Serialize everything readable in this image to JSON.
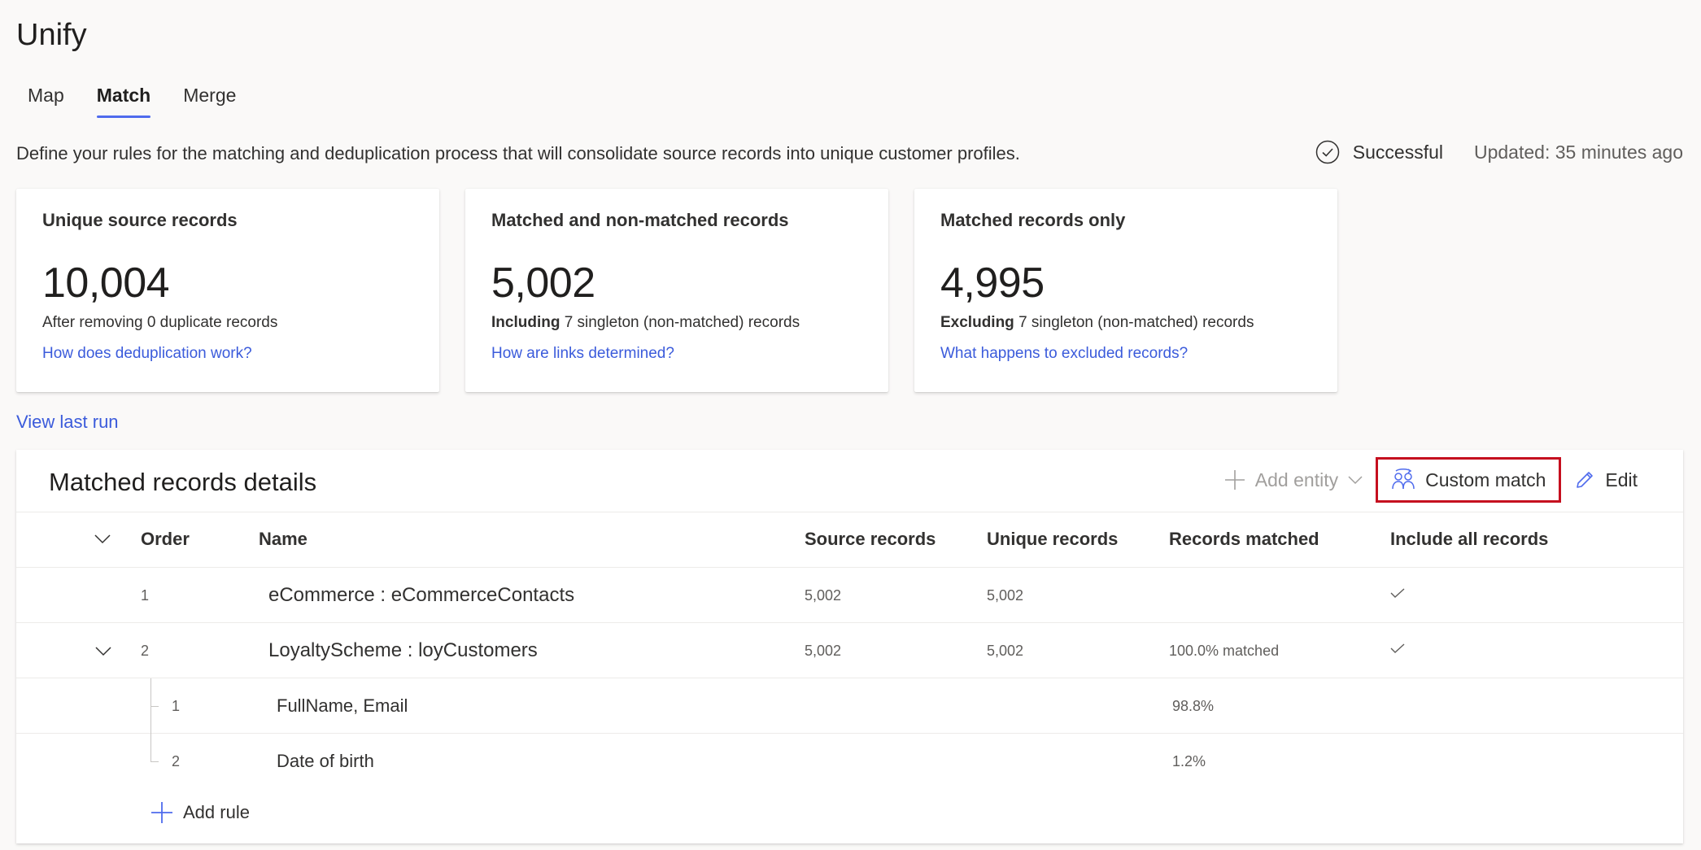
{
  "page": {
    "title": "Unify",
    "tabs": [
      {
        "label": "Map"
      },
      {
        "label": "Match"
      },
      {
        "label": "Merge"
      }
    ],
    "active_tab": "Match",
    "description": "Define your rules for the matching and deduplication process that will consolidate source records into unique customer profiles.",
    "status": {
      "label": "Successful",
      "updated": "Updated: 35 minutes ago"
    }
  },
  "cards": [
    {
      "title": "Unique source records",
      "value": "10,004",
      "sub_bold": "",
      "sub_text": "After removing 0 duplicate records",
      "link": "How does deduplication work?"
    },
    {
      "title": "Matched and non-matched records",
      "value": "5,002",
      "sub_bold": "Including",
      "sub_text": " 7 singleton (non-matched) records",
      "link": "How are links determined?"
    },
    {
      "title": "Matched records only",
      "value": "4,995",
      "sub_bold": "Excluding",
      "sub_text": " 7 singleton (non-matched) records",
      "link": "What happens to excluded records?"
    }
  ],
  "view_last_run": "View last run",
  "details": {
    "title": "Matched records details",
    "toolbar": {
      "add_entity": "Add entity",
      "custom_match": "Custom match",
      "edit": "Edit"
    },
    "columns": {
      "order": "Order",
      "name": "Name",
      "source": "Source records",
      "unique": "Unique records",
      "matched": "Records matched",
      "include_all": "Include all records"
    },
    "rows": [
      {
        "order": "1",
        "name": "eCommerce : eCommerceContacts",
        "source": "5,002",
        "unique": "5,002",
        "matched": "",
        "include_all": true
      },
      {
        "order": "2",
        "name": "LoyaltyScheme : loyCustomers",
        "source": "5,002",
        "unique": "5,002",
        "matched": "100.0% matched",
        "include_all": true
      }
    ],
    "rules": [
      {
        "order": "1",
        "name": "FullName, Email",
        "matched": "98.8%"
      },
      {
        "order": "2",
        "name": "Date of birth",
        "matched": "1.2%"
      }
    ],
    "add_rule": "Add rule"
  },
  "colors": {
    "accent": "#4f6bed",
    "link": "#3b5bdb",
    "highlight_border": "#c50f1f",
    "background": "#faf9f8"
  }
}
